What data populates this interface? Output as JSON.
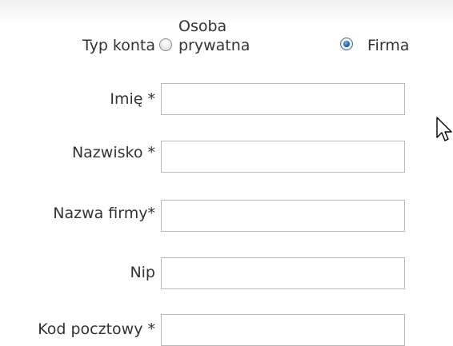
{
  "account_type": {
    "label": "Typ konta",
    "options": [
      {
        "line1": "Osoba",
        "line2": "prywatna",
        "selected": false
      },
      {
        "label": "Firma",
        "selected": true
      }
    ]
  },
  "fields": [
    {
      "label": "Imię *",
      "value": ""
    },
    {
      "label": "Nazwisko *",
      "value": ""
    },
    {
      "label": "Nazwa firmy*",
      "value": ""
    },
    {
      "label": "Nip",
      "value": ""
    },
    {
      "label": "Kod pocztowy *",
      "value": ""
    }
  ],
  "icons": {
    "cursor": "mouse-pointer-icon",
    "radio_unchecked": "radio-unchecked-icon",
    "radio_checked": "radio-checked-icon"
  },
  "colors": {
    "text": "#333333",
    "input_border": "#b9b9b9",
    "radio_selected": "#1f5d9c"
  }
}
